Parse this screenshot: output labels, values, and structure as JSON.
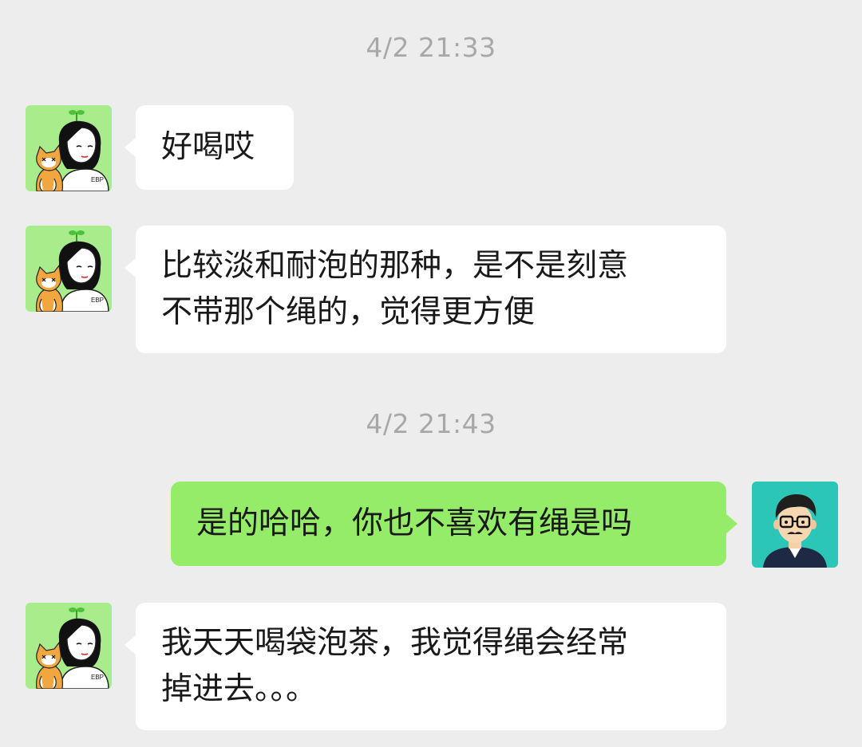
{
  "chat": {
    "timestamps": [
      "4/2 21:33",
      "4/2 21:43"
    ],
    "messages": [
      {
        "sender": "other",
        "text": "好喝哎"
      },
      {
        "sender": "other",
        "text": "比较淡和耐泡的那种，是不是刻意\n不带那个绳的，觉得更方便"
      },
      {
        "sender": "self",
        "text": "是的哈哈，你也不喜欢有绳是吗"
      },
      {
        "sender": "other",
        "text": "我天天喝袋泡茶，我觉得绳会经常\n掉进去。。。"
      }
    ]
  },
  "colors": {
    "background": "#ededed",
    "bubble_other": "#ffffff",
    "bubble_self": "#95ec69",
    "timestamp_text": "#a8a8a8",
    "avatar_other_bg": "#a9ec8c",
    "avatar_self_bg": "#2cc6b8"
  },
  "icons": {
    "avatar_other": "girl-with-cat-avatar-icon",
    "avatar_self": "man-with-glasses-avatar-icon"
  }
}
